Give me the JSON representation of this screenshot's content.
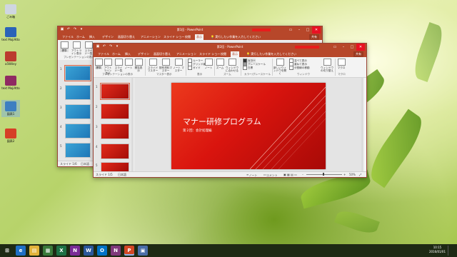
{
  "desktop": {
    "icons": [
      {
        "label": "ごみ箱",
        "color": "#cfd6e0"
      },
      {
        "label": "text MojiAtto",
        "color": "#2b63b8"
      },
      {
        "label": "a5Wiley",
        "color": "#bb3b2e"
      },
      {
        "label": "text MojiAtto",
        "color": "#8f2a62"
      },
      {
        "label": "図表1",
        "color": "#3d7fc1"
      },
      {
        "label": "図表2",
        "color": "#d63f26"
      }
    ]
  },
  "window_back": {
    "title": "第1回 - PowerPoint",
    "tabs": [
      "ファイル",
      "ホーム",
      "挿入",
      "デザイン",
      "画面切り替え",
      "アニメーション",
      "スライド ショー",
      "校閲",
      "表示"
    ],
    "active_tab": "表示",
    "tell_me": "実行したい作業を入力してください",
    "share": "共有",
    "status": "スライド 1/6",
    "status_lang": "日本語",
    "ribbon_buttons": [
      "標準",
      "アウトライン表示",
      "スライド一覧"
    ],
    "ribbon_group": "プレゼンテーションの表示",
    "slide_numbers": [
      "1",
      "2",
      "3",
      "4",
      "5"
    ]
  },
  "window_front": {
    "title": "第2回 - PowerPoint",
    "tabs": [
      "ファイル",
      "ホーム",
      "挿入",
      "デザイン",
      "画面切り替え",
      "アニメーション",
      "スライド ショー",
      "校閲",
      "表示"
    ],
    "active_tab": "表示",
    "tell_me": "実行したい作業を入力してください",
    "share": "共有",
    "ribbon": {
      "pres_views": [
        "標準",
        "アウトライン表示",
        "スライド一覧",
        "ノート",
        "閲覧表示"
      ],
      "pres_views_group": "プレゼンテーションの表示",
      "master_views": [
        "スライド マスター",
        "配布資料マスター",
        "ノート マスター"
      ],
      "master_views_group": "マスター表示",
      "show_opts": [
        "ルーラー",
        "グリッド線",
        "ガイド"
      ],
      "show_group": "表示",
      "notes_btn": "ノート",
      "zoom_btns": [
        "ズーム",
        "ウィンドウに合わせる"
      ],
      "zoom_group": "ズーム",
      "color_opts": [
        "カラー",
        "グレースケール",
        "白黒"
      ],
      "color_group": "カラー/グレースケール",
      "window_btns": [
        "新しいウィンドウを開く",
        "整列",
        "重ねて表示",
        "分割"
      ],
      "window_opts": [
        "並べて表示",
        "重ねて表示",
        "分割線の移動"
      ],
      "window_group": "ウィンドウ",
      "switch_btn": "ウィンドウの切り替え",
      "macro_btn": "マクロ",
      "macro_group": "マクロ"
    },
    "slide": {
      "title": "マナー研修プログラム",
      "subtitle": "第２回：会計処理編",
      "bg_color": "#d9140e"
    },
    "slide_numbers": [
      "1",
      "2",
      "3",
      "4",
      "5"
    ],
    "status": "スライド 1/5",
    "status_lang": "日本語",
    "status_right": [
      "ノート",
      "コメント"
    ],
    "zoom": "50%"
  },
  "taskbar": {
    "items": [
      {
        "name": "start",
        "glyph": "⊞",
        "color": "#1e2a14"
      },
      {
        "name": "ie",
        "glyph": "e",
        "color": "#1f6fc4"
      },
      {
        "name": "explorer",
        "glyph": "▤",
        "color": "#e2b33b"
      },
      {
        "name": "store",
        "glyph": "▦",
        "color": "#3a7a3a"
      },
      {
        "name": "excel",
        "glyph": "X",
        "color": "#1e7145"
      },
      {
        "name": "onenote",
        "glyph": "N",
        "color": "#7a2b96"
      },
      {
        "name": "word",
        "glyph": "W",
        "color": "#2b579a"
      },
      {
        "name": "outlook",
        "glyph": "O",
        "color": "#0072c6"
      },
      {
        "name": "onenote2",
        "glyph": "N",
        "color": "#80397b"
      },
      {
        "name": "powerpoint",
        "glyph": "P",
        "color": "#d24726",
        "active": true
      },
      {
        "name": "misc",
        "glyph": "▣",
        "color": "#4b6ea8"
      }
    ],
    "clock_time": "10:15",
    "clock_date": "2016/01/01"
  }
}
